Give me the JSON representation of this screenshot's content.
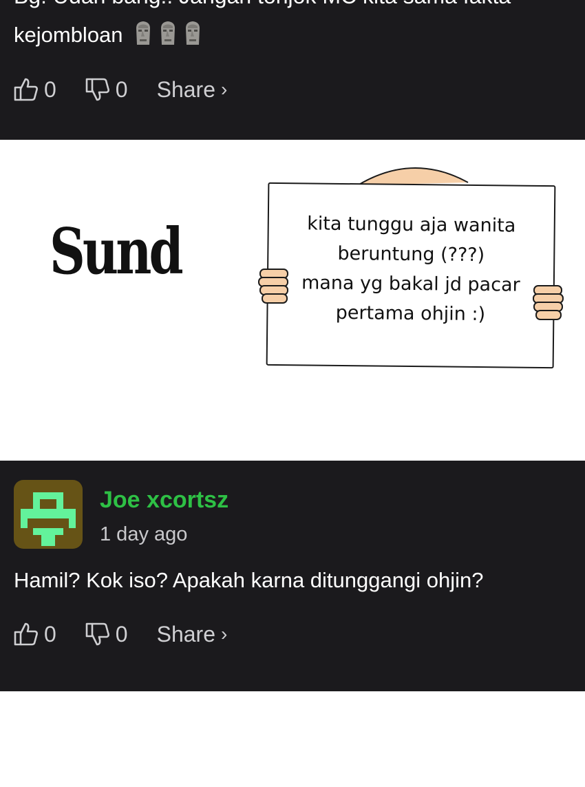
{
  "top_comment": {
    "cut_line": "Bg! Udah bang!! Jangan tonjok MC kita sama fakta",
    "line2": "kejombloan",
    "emoji_icons": [
      "moai-icon",
      "moai-icon",
      "moai-icon"
    ],
    "likes": "0",
    "dislikes": "0",
    "share_label": "Share",
    "share_chevron": "›"
  },
  "panel": {
    "sund_text": "Sund",
    "sign_lines": [
      "kita tunggu aja wanita",
      "beruntung (???)",
      "mana yg bakal jd pacar",
      "pertama ohjin :)"
    ]
  },
  "comment2": {
    "username": "Joe xcortsz",
    "time": "1 day ago",
    "text": "Hamil? Kok iso? Apakah karna ditunggangi ohjin?",
    "likes": "0",
    "dislikes": "0",
    "share_label": "Share",
    "share_chevron": "›",
    "username_color": "#2ec045",
    "avatar_bg": "#665316",
    "avatar_fg": "#63f29b"
  }
}
